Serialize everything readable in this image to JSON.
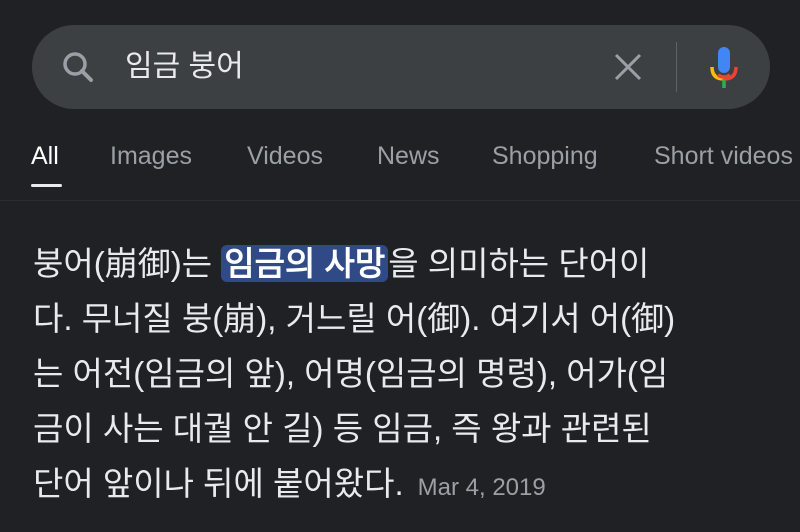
{
  "search": {
    "query": "임금 붕어",
    "icons": {
      "search": "search-icon",
      "clear": "close-icon",
      "voice": "mic-icon"
    },
    "mic_colors": [
      "#4285f4",
      "#ea4335",
      "#fbbc04",
      "#34a853"
    ]
  },
  "tabs": [
    {
      "label": "All",
      "active": true
    },
    {
      "label": "Images"
    },
    {
      "label": "Videos"
    },
    {
      "label": "News"
    },
    {
      "label": "Shopping"
    },
    {
      "label": "Short videos"
    }
  ],
  "snippet": {
    "line1_before": "붕어(崩御)는 ",
    "line1_highlight": "임금의 사망",
    "line1_after": "을 의미하는 단어이",
    "line2": "다. 무너질 붕(崩), 거느릴 어(御). 여기서 어(御)",
    "line3": "는 어전(임금의 앞), 어명(임금의 명령), 어가(임",
    "line4": "금이 사는 대궐 안 길) 등 임금, 즉 왕과 관련된",
    "line5": "단어 앞이나 뒤에 붙어왔다.",
    "date": "Mar 4, 2019",
    "highlight_color": "#2f4a86"
  }
}
